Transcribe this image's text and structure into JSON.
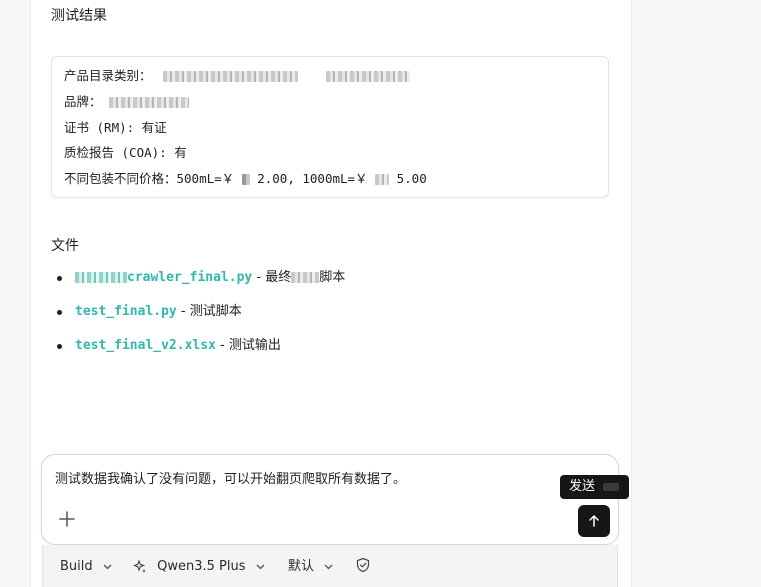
{
  "content": {
    "test_results_heading": "测试结果",
    "code_lines": [
      "产品目录类别：",
      "品牌：",
      "证书 (RM): 有证",
      "质检报告 (COA): 有",
      "不同包装不同价格：500mL=￥",
      "2.00, 1000mL=￥",
      "5.00"
    ],
    "files_heading": "文件",
    "files": [
      {
        "name": "crawler_final.py",
        "desc": " - 最终",
        "desc_suffix": "脚本"
      },
      {
        "name": "test_final.py",
        "desc": " - 测试脚本"
      },
      {
        "name": "test_final_v2.xlsx",
        "desc": " - 测试输出"
      }
    ]
  },
  "composer": {
    "message": "测试数据我确认了没有问题，可以开始翻页爬取所有数据了。",
    "send_tooltip": "发送",
    "plus_icon": "plus-icon",
    "send_icon": "arrow-up-icon"
  },
  "toolbar": {
    "mode": "Build",
    "model": "Qwen3.5 Plus",
    "variant": "默认",
    "icons": [
      "chevron-down-icon",
      "sparkle-icon",
      "shield-check-icon"
    ]
  },
  "colors": {
    "link": "#2fb8ad",
    "send_button": "#161616",
    "background": "#f7f7f8"
  }
}
